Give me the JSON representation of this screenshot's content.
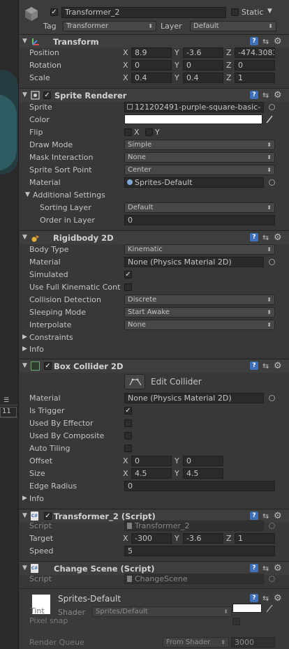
{
  "header": {
    "name": "Transformer_2",
    "static_label": "Static",
    "tag_label": "Tag",
    "tag_value": "Transformer",
    "layer_label": "Layer",
    "layer_value": "Default"
  },
  "transform": {
    "title": "Transform",
    "position_label": "Position",
    "rotation_label": "Rotation",
    "scale_label": "Scale",
    "position": {
      "x": "8.9",
      "y": "-3.6",
      "z": "-474.3083"
    },
    "rotation": {
      "x": "0",
      "y": "0",
      "z": "0"
    },
    "scale": {
      "x": "0.4",
      "y": "0.4",
      "z": "1"
    }
  },
  "sprite_renderer": {
    "title": "Sprite Renderer",
    "sprite_label": "Sprite",
    "sprite_value": "121202491-purple-square-basic-",
    "color_label": "Color",
    "flip_label": "Flip",
    "flip_x": "X",
    "flip_y": "Y",
    "draw_mode_label": "Draw Mode",
    "draw_mode_value": "Simple",
    "mask_label": "Mask Interaction",
    "mask_value": "None",
    "sort_point_label": "Sprite Sort Point",
    "sort_point_value": "Center",
    "material_label": "Material",
    "material_value": "Sprites-Default",
    "additional_label": "Additional Settings",
    "sorting_layer_label": "Sorting Layer",
    "sorting_layer_value": "Default",
    "order_label": "Order in Layer",
    "order_value": "0"
  },
  "rigidbody": {
    "title": "Rigidbody 2D",
    "body_type_label": "Body Type",
    "body_type_value": "Kinematic",
    "material_label": "Material",
    "material_value": "None (Physics Material 2D)",
    "simulated_label": "Simulated",
    "full_kinematic_label": "Use Full Kinematic Cont",
    "collision_label": "Collision Detection",
    "collision_value": "Discrete",
    "sleeping_label": "Sleeping Mode",
    "sleeping_value": "Start Awake",
    "interpolate_label": "Interpolate",
    "interpolate_value": "None",
    "constraints_label": "Constraints",
    "info_label": "Info"
  },
  "box_collider": {
    "title": "Box Collider 2D",
    "edit_label": "Edit Collider",
    "material_label": "Material",
    "material_value": "None (Physics Material 2D)",
    "is_trigger_label": "Is Trigger",
    "effector_label": "Used By Effector",
    "composite_label": "Used By Composite",
    "auto_tiling_label": "Auto Tiling",
    "offset_label": "Offset",
    "offset": {
      "x": "0",
      "y": "0"
    },
    "size_label": "Size",
    "size": {
      "x": "4.5",
      "y": "4.5"
    },
    "edge_radius_label": "Edge Radius",
    "edge_radius_value": "0",
    "info_label": "Info"
  },
  "transformer_script": {
    "title": "Transformer_2 (Script)",
    "script_label": "Script",
    "script_value": "Transformer_2",
    "target_label": "Target",
    "target": {
      "x": "-300",
      "y": "-3.6",
      "z": "1"
    },
    "speed_label": "Speed",
    "speed_value": "5"
  },
  "change_scene": {
    "title": "Change Scene (Script)",
    "script_label": "Script",
    "script_value": "ChangeScene"
  },
  "material_preview": {
    "name": "Sprites-Default",
    "shader_label": "Shader",
    "shader_value": "Sprites/Default",
    "tint_label": "Tint",
    "pixel_snap_label": "Pixel snap",
    "render_queue_label": "Render Queue",
    "render_queue_mode": "From Shader",
    "render_queue_value": "3000"
  },
  "left_strip": {
    "value": "11"
  },
  "axis": {
    "x": "X",
    "y": "Y",
    "z": "Z"
  },
  "colors": {
    "panel_bg": "#383838",
    "help_icon": "#3f6fb4",
    "collider_green": "#6fa86f",
    "teal_scene": "#2f5c63"
  }
}
